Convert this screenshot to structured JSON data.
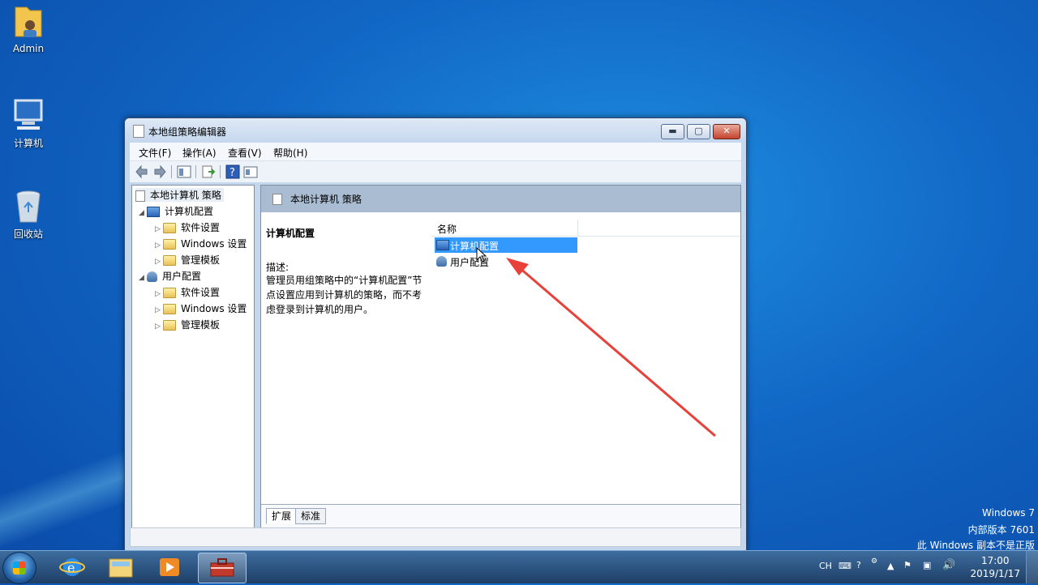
{
  "desktop": {
    "icons": [
      {
        "label": "Admin",
        "icon": "user-folder-icon"
      },
      {
        "label": "计算机",
        "icon": "computer-icon"
      },
      {
        "label": "回收站",
        "icon": "recycle-bin-icon"
      }
    ],
    "watermark": {
      "line1": "Windows 7",
      "line2": "内部版本 7601",
      "line3": "此 Windows 副本不是正版"
    }
  },
  "window": {
    "title": "本地组策略编辑器",
    "controls": {
      "minimize": "▬",
      "maximize": "▢",
      "close": "✕"
    },
    "menu": [
      "文件(F)",
      "操作(A)",
      "查看(V)",
      "帮助(H)"
    ],
    "tree": {
      "root": "本地计算机 策略",
      "computer_config": "计算机配置",
      "computer_children": [
        "软件设置",
        "Windows 设置",
        "管理模板"
      ],
      "user_config": "用户配置",
      "user_children": [
        "软件设置",
        "Windows 设置",
        "管理模板"
      ]
    },
    "right_pane": {
      "header": "本地计算机 策略",
      "desc_title": "计算机配置",
      "desc_label": "描述:",
      "desc_text": "管理员用组策略中的“计算机配置”节点设置应用到计算机的策略，而不考虑登录到计算机的用户。",
      "column_name": "名称",
      "items": [
        {
          "label": "计算机配置",
          "selected": true
        },
        {
          "label": "用户配置",
          "selected": false
        }
      ],
      "tabs": [
        "扩展",
        "标准"
      ]
    }
  },
  "taskbar": {
    "apps": [
      "internet-explorer-icon",
      "file-explorer-icon",
      "media-player-icon",
      "group-policy-editor-icon"
    ],
    "tray": {
      "lang": "CH",
      "time": "17:00",
      "date": "2019/1/17"
    }
  },
  "colors": {
    "selection": "#3399ff",
    "arrow": "#e8413a",
    "desktop": "#1166c4"
  }
}
